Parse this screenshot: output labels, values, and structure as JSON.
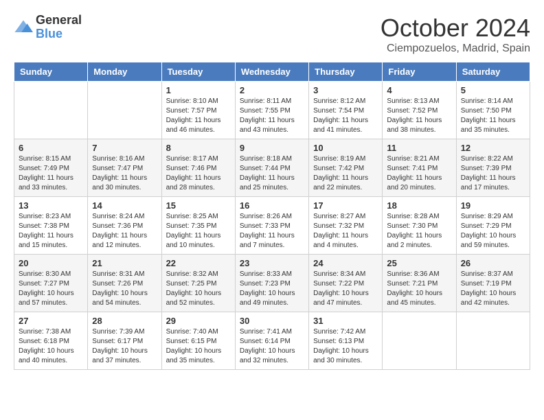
{
  "header": {
    "logo_general": "General",
    "logo_blue": "Blue",
    "month": "October 2024",
    "location": "Ciempozuelos, Madrid, Spain"
  },
  "days_of_week": [
    "Sunday",
    "Monday",
    "Tuesday",
    "Wednesday",
    "Thursday",
    "Friday",
    "Saturday"
  ],
  "weeks": [
    [
      {
        "day": "",
        "sunrise": "",
        "sunset": "",
        "daylight": ""
      },
      {
        "day": "",
        "sunrise": "",
        "sunset": "",
        "daylight": ""
      },
      {
        "day": "1",
        "sunrise": "Sunrise: 8:10 AM",
        "sunset": "Sunset: 7:57 PM",
        "daylight": "Daylight: 11 hours and 46 minutes."
      },
      {
        "day": "2",
        "sunrise": "Sunrise: 8:11 AM",
        "sunset": "Sunset: 7:55 PM",
        "daylight": "Daylight: 11 hours and 43 minutes."
      },
      {
        "day": "3",
        "sunrise": "Sunrise: 8:12 AM",
        "sunset": "Sunset: 7:54 PM",
        "daylight": "Daylight: 11 hours and 41 minutes."
      },
      {
        "day": "4",
        "sunrise": "Sunrise: 8:13 AM",
        "sunset": "Sunset: 7:52 PM",
        "daylight": "Daylight: 11 hours and 38 minutes."
      },
      {
        "day": "5",
        "sunrise": "Sunrise: 8:14 AM",
        "sunset": "Sunset: 7:50 PM",
        "daylight": "Daylight: 11 hours and 35 minutes."
      }
    ],
    [
      {
        "day": "6",
        "sunrise": "Sunrise: 8:15 AM",
        "sunset": "Sunset: 7:49 PM",
        "daylight": "Daylight: 11 hours and 33 minutes."
      },
      {
        "day": "7",
        "sunrise": "Sunrise: 8:16 AM",
        "sunset": "Sunset: 7:47 PM",
        "daylight": "Daylight: 11 hours and 30 minutes."
      },
      {
        "day": "8",
        "sunrise": "Sunrise: 8:17 AM",
        "sunset": "Sunset: 7:46 PM",
        "daylight": "Daylight: 11 hours and 28 minutes."
      },
      {
        "day": "9",
        "sunrise": "Sunrise: 8:18 AM",
        "sunset": "Sunset: 7:44 PM",
        "daylight": "Daylight: 11 hours and 25 minutes."
      },
      {
        "day": "10",
        "sunrise": "Sunrise: 8:19 AM",
        "sunset": "Sunset: 7:42 PM",
        "daylight": "Daylight: 11 hours and 22 minutes."
      },
      {
        "day": "11",
        "sunrise": "Sunrise: 8:21 AM",
        "sunset": "Sunset: 7:41 PM",
        "daylight": "Daylight: 11 hours and 20 minutes."
      },
      {
        "day": "12",
        "sunrise": "Sunrise: 8:22 AM",
        "sunset": "Sunset: 7:39 PM",
        "daylight": "Daylight: 11 hours and 17 minutes."
      }
    ],
    [
      {
        "day": "13",
        "sunrise": "Sunrise: 8:23 AM",
        "sunset": "Sunset: 7:38 PM",
        "daylight": "Daylight: 11 hours and 15 minutes."
      },
      {
        "day": "14",
        "sunrise": "Sunrise: 8:24 AM",
        "sunset": "Sunset: 7:36 PM",
        "daylight": "Daylight: 11 hours and 12 minutes."
      },
      {
        "day": "15",
        "sunrise": "Sunrise: 8:25 AM",
        "sunset": "Sunset: 7:35 PM",
        "daylight": "Daylight: 11 hours and 10 minutes."
      },
      {
        "day": "16",
        "sunrise": "Sunrise: 8:26 AM",
        "sunset": "Sunset: 7:33 PM",
        "daylight": "Daylight: 11 hours and 7 minutes."
      },
      {
        "day": "17",
        "sunrise": "Sunrise: 8:27 AM",
        "sunset": "Sunset: 7:32 PM",
        "daylight": "Daylight: 11 hours and 4 minutes."
      },
      {
        "day": "18",
        "sunrise": "Sunrise: 8:28 AM",
        "sunset": "Sunset: 7:30 PM",
        "daylight": "Daylight: 11 hours and 2 minutes."
      },
      {
        "day": "19",
        "sunrise": "Sunrise: 8:29 AM",
        "sunset": "Sunset: 7:29 PM",
        "daylight": "Daylight: 10 hours and 59 minutes."
      }
    ],
    [
      {
        "day": "20",
        "sunrise": "Sunrise: 8:30 AM",
        "sunset": "Sunset: 7:27 PM",
        "daylight": "Daylight: 10 hours and 57 minutes."
      },
      {
        "day": "21",
        "sunrise": "Sunrise: 8:31 AM",
        "sunset": "Sunset: 7:26 PM",
        "daylight": "Daylight: 10 hours and 54 minutes."
      },
      {
        "day": "22",
        "sunrise": "Sunrise: 8:32 AM",
        "sunset": "Sunset: 7:25 PM",
        "daylight": "Daylight: 10 hours and 52 minutes."
      },
      {
        "day": "23",
        "sunrise": "Sunrise: 8:33 AM",
        "sunset": "Sunset: 7:23 PM",
        "daylight": "Daylight: 10 hours and 49 minutes."
      },
      {
        "day": "24",
        "sunrise": "Sunrise: 8:34 AM",
        "sunset": "Sunset: 7:22 PM",
        "daylight": "Daylight: 10 hours and 47 minutes."
      },
      {
        "day": "25",
        "sunrise": "Sunrise: 8:36 AM",
        "sunset": "Sunset: 7:21 PM",
        "daylight": "Daylight: 10 hours and 45 minutes."
      },
      {
        "day": "26",
        "sunrise": "Sunrise: 8:37 AM",
        "sunset": "Sunset: 7:19 PM",
        "daylight": "Daylight: 10 hours and 42 minutes."
      }
    ],
    [
      {
        "day": "27",
        "sunrise": "Sunrise: 7:38 AM",
        "sunset": "Sunset: 6:18 PM",
        "daylight": "Daylight: 10 hours and 40 minutes."
      },
      {
        "day": "28",
        "sunrise": "Sunrise: 7:39 AM",
        "sunset": "Sunset: 6:17 PM",
        "daylight": "Daylight: 10 hours and 37 minutes."
      },
      {
        "day": "29",
        "sunrise": "Sunrise: 7:40 AM",
        "sunset": "Sunset: 6:15 PM",
        "daylight": "Daylight: 10 hours and 35 minutes."
      },
      {
        "day": "30",
        "sunrise": "Sunrise: 7:41 AM",
        "sunset": "Sunset: 6:14 PM",
        "daylight": "Daylight: 10 hours and 32 minutes."
      },
      {
        "day": "31",
        "sunrise": "Sunrise: 7:42 AM",
        "sunset": "Sunset: 6:13 PM",
        "daylight": "Daylight: 10 hours and 30 minutes."
      },
      {
        "day": "",
        "sunrise": "",
        "sunset": "",
        "daylight": ""
      },
      {
        "day": "",
        "sunrise": "",
        "sunset": "",
        "daylight": ""
      }
    ]
  ]
}
